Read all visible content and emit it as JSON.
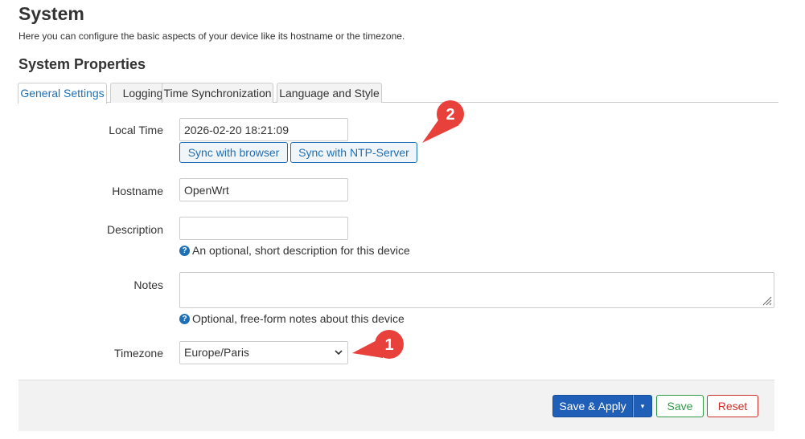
{
  "page": {
    "title": "System",
    "description": "Here you can configure the basic aspects of your device like its hostname or the timezone."
  },
  "section": {
    "title": "System Properties"
  },
  "tabs": [
    {
      "label": "General Settings",
      "active": true
    },
    {
      "label": "Logging",
      "active": false
    },
    {
      "label": "Time Synchronization",
      "active": false
    },
    {
      "label": "Language and Style",
      "active": false
    }
  ],
  "form": {
    "local_time": {
      "label": "Local Time",
      "value": "2026-02-20 18:21:09",
      "sync_browser_label": "Sync with browser",
      "sync_ntp_label": "Sync with NTP-Server"
    },
    "hostname": {
      "label": "Hostname",
      "value": "OpenWrt"
    },
    "description": {
      "label": "Description",
      "value": "",
      "help": "An optional, short description for this device"
    },
    "notes": {
      "label": "Notes",
      "value": "",
      "help": "Optional, free-form notes about this device"
    },
    "timezone": {
      "label": "Timezone",
      "selected": "Europe/Paris"
    }
  },
  "footer": {
    "save_apply_label": "Save & Apply",
    "dropdown_glyph": "▾",
    "save_label": "Save",
    "reset_label": "Reset"
  },
  "annotations": [
    {
      "number": "1",
      "target": "timezone"
    },
    {
      "number": "2",
      "target": "sync-ntp"
    }
  ],
  "colors": {
    "accent": "#1f6fb4",
    "primary_button": "#1f5fb8",
    "save": "#2e9a48",
    "reset": "#c9302c",
    "callout": "#e8413c"
  },
  "icons": {
    "help": "question-circle-icon",
    "chevron": "chevron-down-icon",
    "resize": "resize-grip-icon"
  }
}
